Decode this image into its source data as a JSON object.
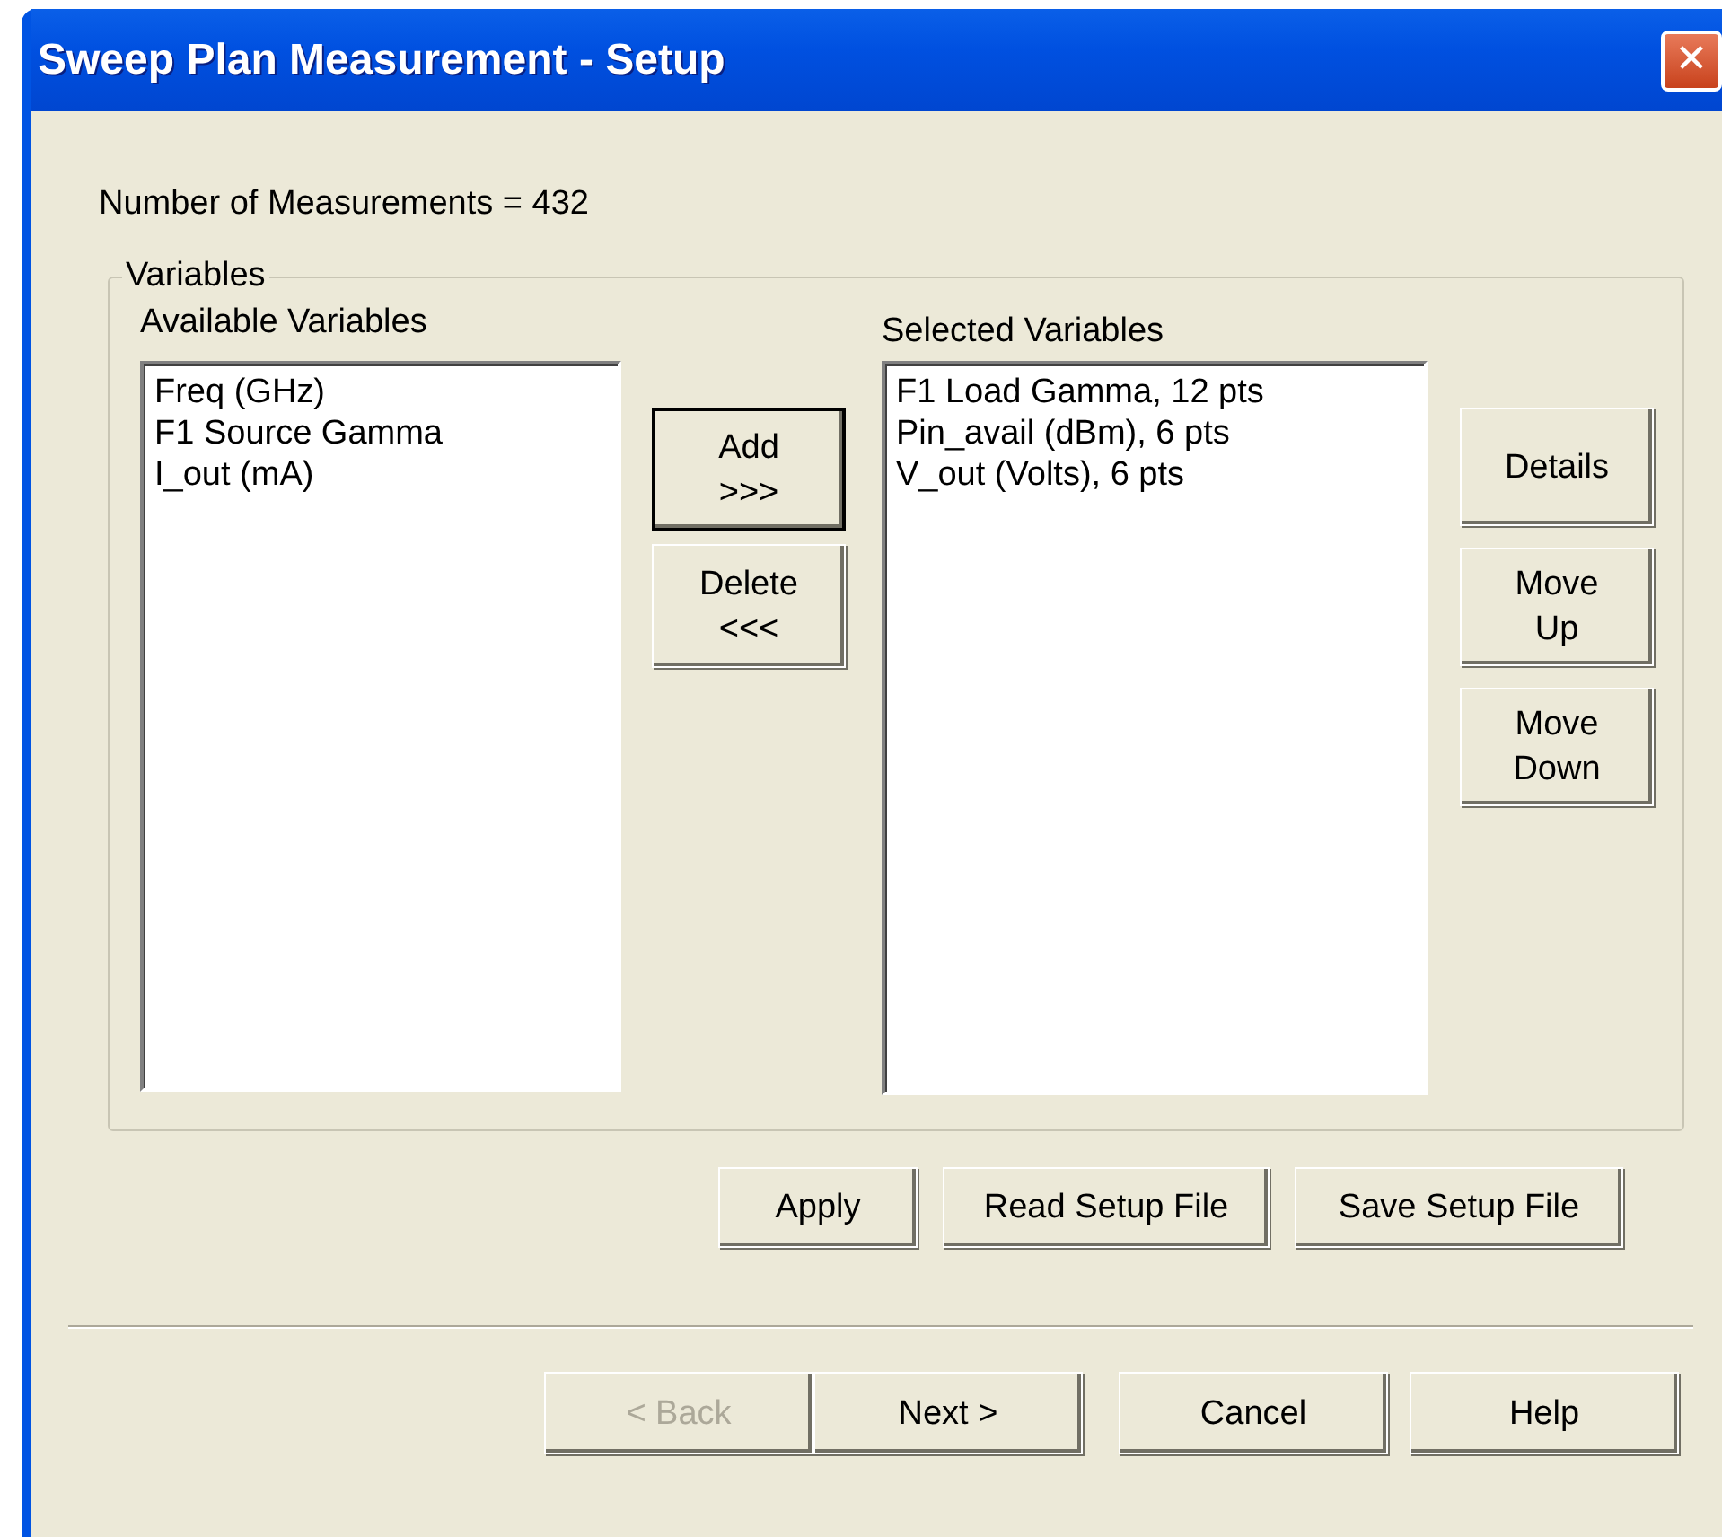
{
  "window": {
    "title": "Sweep Plan Measurement - Setup",
    "close": "✕"
  },
  "summary": "Number of Measurements = 432",
  "group": {
    "title": "Variables",
    "available": {
      "label": "Available Variables",
      "items": [
        "Freq (GHz)",
        "F1 Source Gamma",
        "I_out (mA)"
      ]
    },
    "transfer_buttons": [
      {
        "lines": [
          "Add",
          ">>>"
        ],
        "default": true
      },
      {
        "lines": [
          "Delete",
          "<<<"
        ],
        "default": false
      }
    ],
    "selected": {
      "label": "Selected Variables",
      "items": [
        "F1 Load Gamma, 12 pts",
        "Pin_avail (dBm), 6 pts",
        "V_out (Volts), 6 pts"
      ]
    },
    "order_buttons": [
      {
        "lines": [
          "Details"
        ]
      },
      {
        "lines": [
          "Move",
          "Up"
        ]
      },
      {
        "lines": [
          "Move",
          "Down"
        ]
      }
    ]
  },
  "file_buttons": [
    "Apply",
    "Read Setup File",
    "Save Setup File"
  ],
  "wizard_buttons": [
    {
      "label": "< Back",
      "disabled": true
    },
    {
      "label": "Next >",
      "disabled": false
    },
    {
      "label": "Cancel",
      "disabled": false
    },
    {
      "label": "Help",
      "disabled": false
    }
  ]
}
